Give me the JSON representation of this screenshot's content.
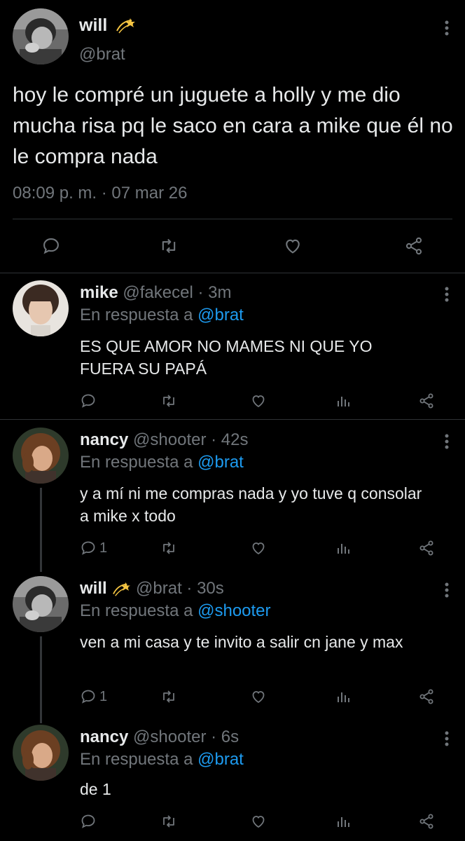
{
  "main_tweet": {
    "name": "will",
    "name_emoji": "💫",
    "handle": "@brat",
    "text": "hoy le compré un juguete a holly y me dio mucha risa pq le saco en cara a mike que él no le compra nada",
    "timestamp": "08:09 p. m. · 07 mar 26"
  },
  "replies": [
    {
      "name": "mike",
      "handle": "@fakecel",
      "time": "· 3m",
      "in_reply_prefix": "En respuesta a",
      "in_reply_to": "@brat",
      "text": "ES QUE AMOR NO MAMES NI QUE YO FUERA SU PAPÁ",
      "reply_count": ""
    },
    {
      "name": "nancy",
      "handle": "@shooter",
      "time": "· 42s",
      "in_reply_prefix": "En respuesta a",
      "in_reply_to": "@brat",
      "text": "y a mí ni me compras nada y yo tuve q consolar a mike x todo",
      "reply_count": "1"
    },
    {
      "name": "will",
      "name_emoji": "💫",
      "handle": "@brat",
      "time": "· 30s",
      "in_reply_prefix": "En respuesta a",
      "in_reply_to": "@shooter",
      "text": "ven a mi casa y te invito a salir cn jane y max",
      "reply_count": "1"
    },
    {
      "name": "nancy",
      "handle": "@shooter",
      "time": "· 6s",
      "in_reply_prefix": "En respuesta a",
      "in_reply_to": "@brat",
      "text": "de 1",
      "reply_count": ""
    }
  ],
  "icons": {
    "reply": "speech-bubble-icon",
    "retweet": "retweet-icon",
    "like": "heart-icon",
    "analytics": "bar-chart-icon",
    "share": "share-icon",
    "more": "vertical-dots-icon",
    "emoji": "dizzy-star-emoji"
  },
  "colors": {
    "background": "#000000",
    "text": "#e7e9ea",
    "secondary": "#71767b",
    "mention": "#1d9bf0",
    "divider": "#2f3336"
  }
}
